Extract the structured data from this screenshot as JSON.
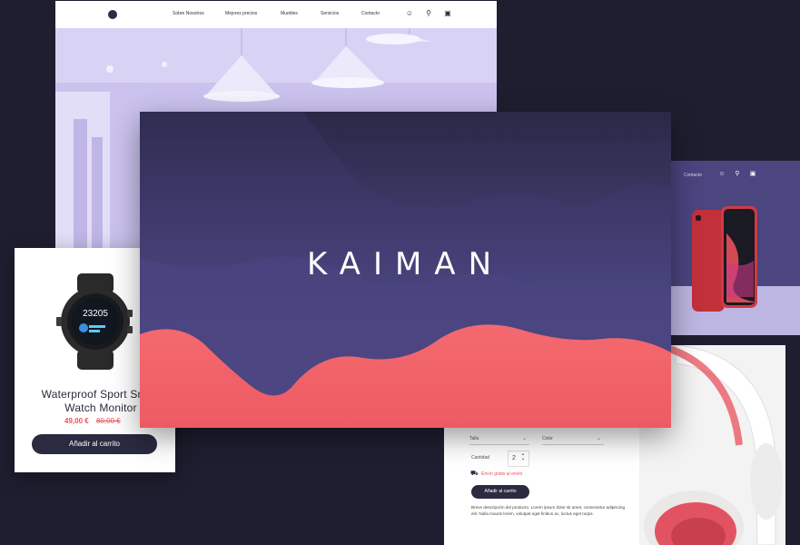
{
  "site": {
    "nav": [
      "Sobre Nosotros",
      "Mejores precios",
      "Muebles",
      "Servicios",
      "Contacto"
    ],
    "icons": [
      "user-icon",
      "search-icon",
      "cart-icon"
    ]
  },
  "hero": {
    "brand": "KAIMAN"
  },
  "product_card": {
    "title": "Waterproof Sport Smart\nWatch Monitor",
    "price": "49,00 €",
    "old_price": "80,00 €",
    "button": "Añadir al carrito",
    "watch_display": "23205"
  },
  "phone_shot": {
    "nav_label": "Contacto",
    "icons": [
      "user-icon",
      "search-icon",
      "cart-icon"
    ]
  },
  "detail": {
    "size_select": "Talla",
    "color_select": "Color",
    "qty_label": "Cantidad",
    "qty_value": "2",
    "shipping": "Envío gratis al envío",
    "button": "Añadir al carrito",
    "description": "Breve descripción del producto. Lorem ipsum dolor sit amet, consectetur adipiscing elit. Nulla mauris lorem, volutpat eget finibus ac, luctus eget turpis."
  },
  "colors": {
    "background": "#1e1e30",
    "accent": "#e8505b",
    "purple": "#4b4580"
  }
}
